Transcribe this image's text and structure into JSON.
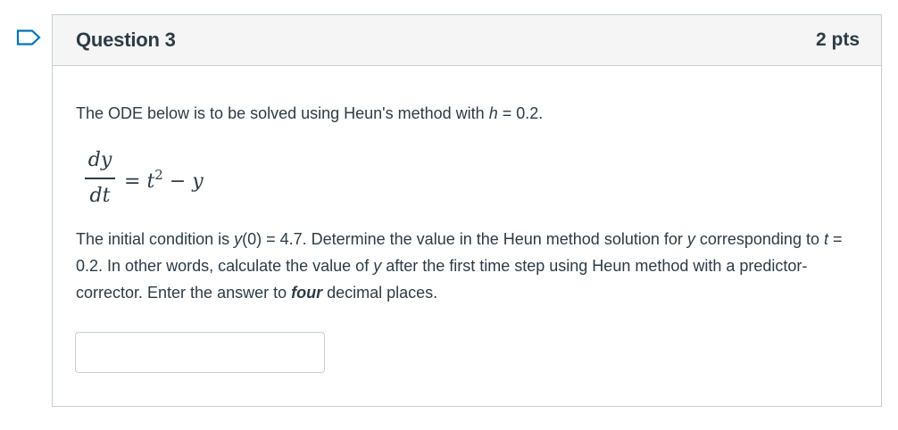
{
  "question": {
    "title": "Question 3",
    "points": "2 pts",
    "intro": {
      "before_h": "The ODE below is to be solved using Heun's method with ",
      "h_var": "h",
      "after_h": " = 0.2."
    },
    "equation": {
      "numerator": "dy",
      "denominator": "dt",
      "equals": "=",
      "t_var": "t",
      "exponent": "2",
      "minus": " − ",
      "y_var": "y"
    },
    "instructions": {
      "s1": "The initial condition is ",
      "s2": "y",
      "s3": "(0) = 4.7.  Determine the value in the Heun method solution for ",
      "s4": "y",
      "s5": " corresponding to ",
      "s6": "t",
      "s7": " = 0.2.  In other words, calculate the value of ",
      "s8": "y",
      "s9": " after the first time step using Heun method with a predictor-corrector.  Enter the answer to ",
      "s10": "four",
      "s11": " decimal places."
    },
    "answer_value": ""
  },
  "colors": {
    "text": "#2d3b45",
    "header_bg": "#f5f5f5",
    "border": "#c7cdd1",
    "flag": "#0374b5"
  },
  "icons": {
    "flag": "bookmark-flag-icon"
  }
}
